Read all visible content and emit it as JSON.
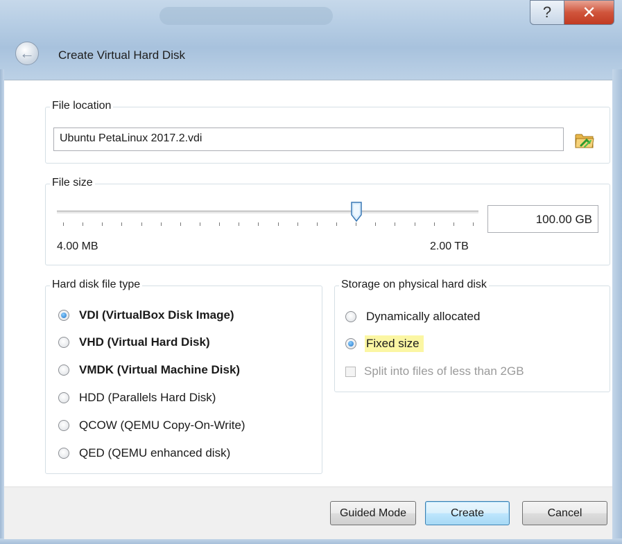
{
  "window": {
    "title": "Create Virtual Hard Disk",
    "help_glyph": "?",
    "close_glyph": "✕",
    "back_glyph": "←"
  },
  "file_location": {
    "group_title": "File location",
    "value": "Ubuntu PetaLinux 2017.2.vdi",
    "browse_icon": "folder-icon"
  },
  "file_size": {
    "group_title": "File size",
    "value": "100.00 GB",
    "min_label": "4.00 MB",
    "max_label": "2.00 TB",
    "slider_position": 0.71
  },
  "disk_type": {
    "group_title": "Hard disk file type",
    "options": [
      {
        "label": "VDI (VirtualBox Disk Image)",
        "checked": true
      },
      {
        "label": "VHD (Virtual Hard Disk)",
        "checked": false
      },
      {
        "label": "VMDK (Virtual Machine Disk)",
        "checked": false
      },
      {
        "label": "HDD (Parallels Hard Disk)",
        "checked": false
      },
      {
        "label": "QCOW (QEMU Copy-On-Write)",
        "checked": false
      },
      {
        "label": "QED (QEMU enhanced disk)",
        "checked": false
      }
    ]
  },
  "storage": {
    "group_title": "Storage on physical hard disk",
    "options": [
      {
        "label": "Dynamically allocated",
        "checked": false
      },
      {
        "label": "Fixed size",
        "checked": true
      }
    ],
    "split_label": "Split into files of less than 2GB",
    "split_enabled": false,
    "highlight_color": "#fbf6a3"
  },
  "buttons": {
    "guided_mode": "Guided Mode",
    "create": "Create",
    "cancel": "Cancel"
  },
  "colors": {
    "close_button": "#c13a22",
    "primary_button_border": "#3c7fb1"
  }
}
